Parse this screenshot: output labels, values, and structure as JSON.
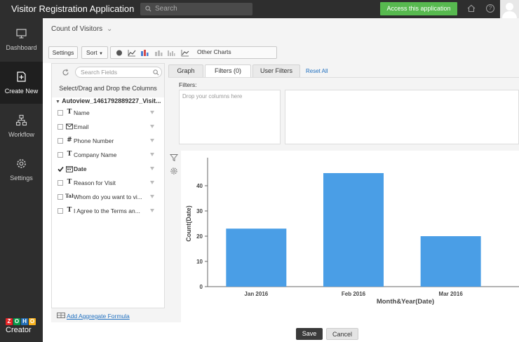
{
  "app": {
    "title": "Visitor Registration Application"
  },
  "header": {
    "search_placeholder": "Search",
    "access_button": "Access this application"
  },
  "sidebar": {
    "items": [
      {
        "label": "Dashboard",
        "icon": "monitor-icon"
      },
      {
        "label": "Create New",
        "icon": "add-page-icon",
        "active": true
      },
      {
        "label": "Workflow",
        "icon": "workflow-icon"
      },
      {
        "label": "Settings",
        "icon": "gear-icon"
      }
    ],
    "logo_letters": [
      "Z",
      "O",
      "H",
      "O"
    ],
    "logo_colors": [
      "#e42527",
      "#089949",
      "#226db4",
      "#f9b21d"
    ],
    "logo_text": "Creator"
  },
  "breadcrumb": "Count of Visitors",
  "toolbar": {
    "settings": "Settings",
    "sort": "Sort",
    "other_charts": "Other Charts"
  },
  "fields_panel": {
    "search_placeholder": "Search Fields",
    "title": "Select/Drag and Drop the Columns",
    "view_name": "Autoview_1461792889227_Visit...",
    "fields": [
      {
        "type": "T",
        "name": "Name",
        "checked": false
      },
      {
        "type": "email-icon",
        "name": "Email",
        "checked": false
      },
      {
        "type": "#",
        "name": "Phone Number",
        "checked": false
      },
      {
        "type": "T",
        "name": "Company Name",
        "checked": false
      },
      {
        "type": "calendar-icon",
        "name": "Date",
        "checked": true
      },
      {
        "type": "T",
        "name": "Reason for Visit",
        "checked": false
      },
      {
        "type": "Tal",
        "name": "Whom do you want to vi...",
        "checked": false
      },
      {
        "type": "T",
        "name": "I Agree to the Terms an...",
        "checked": false
      }
    ],
    "aggregate_link": "Add Aggregate Formula"
  },
  "tabs": [
    {
      "label": "Graph"
    },
    {
      "label": "Filters (0)",
      "active": true
    },
    {
      "label": "User Filters"
    }
  ],
  "reset_all": "Reset All",
  "filters": {
    "label": "Filters:",
    "drop_placeholder": "Drop your columns here"
  },
  "chart_data": {
    "type": "bar",
    "categories": [
      "Jan 2016",
      "Feb 2016",
      "Mar 2016"
    ],
    "values": [
      23,
      45,
      20
    ],
    "xlabel": "Month&Year(Date)",
    "ylabel": "Count(Date)",
    "ylim": [
      0,
      50
    ],
    "yticks": [
      0,
      10,
      20,
      30,
      40
    ],
    "color": "#4a9ee6",
    "grid": false
  },
  "footer": {
    "save": "Save",
    "cancel": "Cancel"
  }
}
